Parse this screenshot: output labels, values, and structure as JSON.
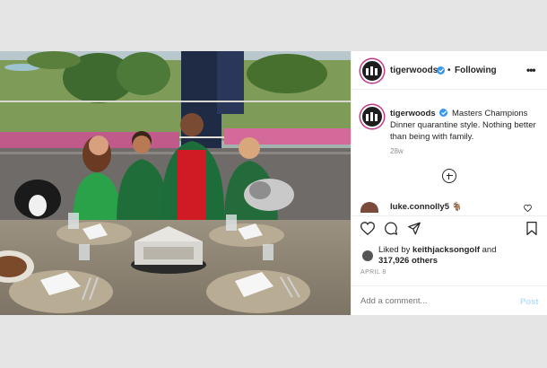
{
  "header": {
    "username": "tigerwoods",
    "separator": "•",
    "follow_label": "Following",
    "more_label": "•••"
  },
  "caption": {
    "username": "tigerwoods",
    "text": "Masters Champions Dinner quarantine style. Nothing better than being with family.",
    "age": "28w"
  },
  "comment": {
    "username": "luke.connolly5",
    "emoji": "🐐"
  },
  "likes": {
    "prefix": "Liked by",
    "user": "keithjacksongolf",
    "joiner": "and",
    "count": "317,926 others"
  },
  "date": "APRIL 8",
  "add_comment": {
    "placeholder": "Add a comment...",
    "post_label": "Post"
  },
  "colors": {
    "verified": "#3897f0",
    "post_disabled": "#b2dffc",
    "story_ring": "#c13584"
  },
  "icons": [
    "heart-icon",
    "comment-icon",
    "share-icon",
    "bookmark-icon",
    "add-icon",
    "verified-icon"
  ]
}
